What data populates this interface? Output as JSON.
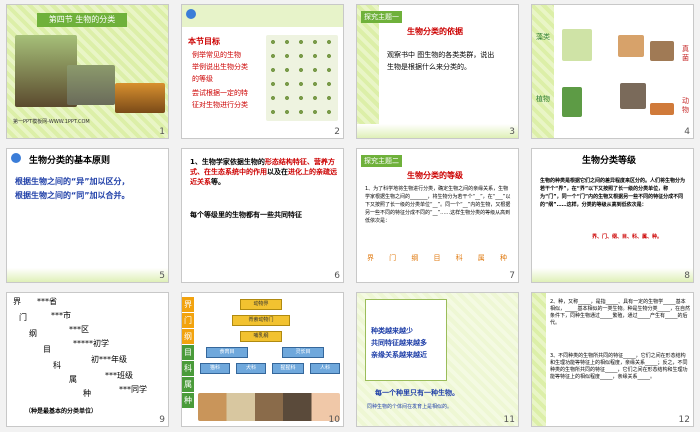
{
  "slides": [
    {
      "num": "1",
      "title": "第四节  生物的分类",
      "footer": "第一PPT模板网-WWW.1PPT.COM"
    },
    {
      "num": "2",
      "heading": "本节目标",
      "lines": [
        "例举常见的生物",
        "举例说出生物分类",
        "的等级",
        "尝试根据一定的特",
        "征对生物进行分类"
      ]
    },
    {
      "num": "3",
      "tag": "探究主题一",
      "title": "生物分类的依据",
      "body": "观察书中  图生物的各类类群，说出生物是根据什么来分类的。"
    },
    {
      "num": "4",
      "labels": [
        "藻类",
        "真菌",
        "植物",
        "动物"
      ]
    },
    {
      "num": "5",
      "title": "生物分类的基本原则",
      "line1": "根据生物之间的“异”加以区分，",
      "line2": "根据生物之间的“同”加以合并。"
    },
    {
      "num": "6",
      "p1a": "1、生物学家依据生物的",
      "p1b": "形态结构特征、营养方式、在生态系统中的作用",
      "p1c": "以及在",
      "p1d": "进化上的亲疏远近关系",
      "p1e": "等。",
      "p2": "每个等级里的生物都有一些共同特征"
    },
    {
      "num": "7",
      "tag": "探究主题二",
      "title": "生物分类的等级",
      "body": "1、为了科学地将生物进行分类，确定生物之间的亲缘关系，生物学家根据生物之间的_______，将生物分为若干个“__”，在“___”以下又按照了长一级的分类单位“__”。同一个“__”内的生物，又根据另一些不同的特征分成不同的“__”……这样生物分类的等级从高到低依次是：",
      "ranks": [
        "界",
        "门",
        "纲",
        "目",
        "科",
        "属",
        "种"
      ]
    },
    {
      "num": "8",
      "title": "生物分类等级",
      "body": "生物的种类是根据它们之间的差异程度来区分的。人们将生物分为若干个“界”，在“界”以下又按照了长一级的分类单位，称为“门”，同一个“门”内的生物又根据另一些不同的特征分成不同的“纲”……这样，分类的等级从高到低依次是：",
      "ranks": "界、门、纲、目、科、属、种。"
    },
    {
      "num": "9",
      "pairs": [
        [
          "界",
          "***省"
        ],
        [
          "门",
          "***市"
        ],
        [
          "纲",
          "***区"
        ],
        [
          "目",
          "*****初学"
        ],
        [
          "科",
          "初***年级"
        ],
        [
          "属",
          "***班级"
        ],
        [
          "种",
          "***同学"
        ]
      ],
      "note": "（种是最基本的分类单位）"
    },
    {
      "num": "10",
      "vlabels": [
        "界",
        "门",
        "纲",
        "目",
        "科",
        "属",
        "种"
      ],
      "nodes": {
        "top": "动物界",
        "l2": "脊索动物门",
        "l3": "哺乳纲",
        "l4": [
          "食肉目",
          "灵长目"
        ],
        "l5": [
          "猫科",
          "犬科",
          "猩猩科",
          "人科"
        ]
      }
    },
    {
      "num": "11",
      "line1": "种类越来越少",
      "line2": "共同特征越来越多",
      "line3": "亲缘关系越来越近",
      "line4": "每一个种里只有一种生物。",
      "line5": "同种生物的个体间在发育上是相似的。"
    },
    {
      "num": "12",
      "body1": "2、种，又称_____，是指_____、具有一定的生物学_____基本相似，_____基本相似的一类生物。种是生物分类_____，在自然条件下，同种生物通过_____繁殖，通过_____产生有_____的后代。",
      "body2": "3、不同种类的生物所共同的特征_____，它们之间在形态结构和生理功能等特征上的相似程度，亲缘关系_____；反之，不同种类的生物所共同的特征_____，它们之间在形态结构和生理功能等特征上的相似程度_____，亲缘关系_____。"
    }
  ],
  "colors": {
    "accent": "#6fb13b",
    "red": "#cc0000",
    "blue": "#1f3fa8",
    "border": "#c8c8c8"
  }
}
